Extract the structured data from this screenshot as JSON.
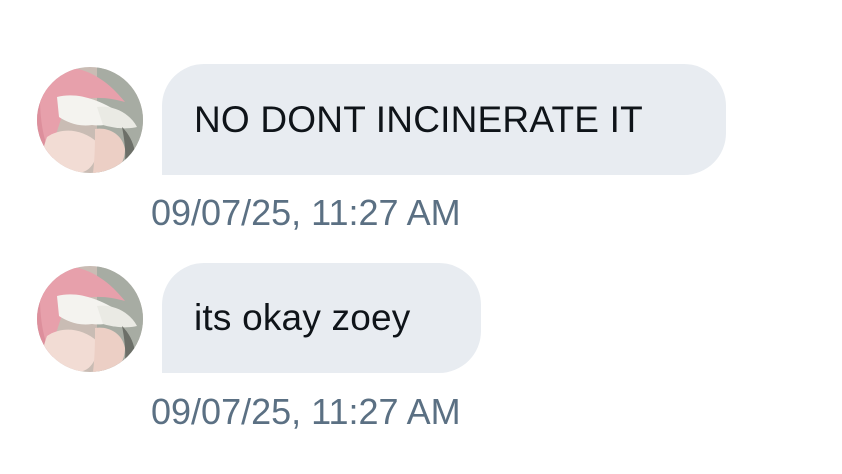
{
  "messages": [
    {
      "avatar_icon": "user-avatar-pink-hair",
      "text": "NO DONT INCINERATE IT",
      "timestamp": "09/07/25, 11:27 AM"
    },
    {
      "avatar_icon": "user-avatar-pink-hair",
      "text": "its okay zoey",
      "timestamp": "09/07/25, 11:27 AM"
    }
  ],
  "colors": {
    "bubble_background": "#e8ecf1",
    "message_text": "#0f1419",
    "timestamp_text": "#5b7083",
    "avatar_hair": "#e7a0ab",
    "avatar_skin": "#f2dcd4",
    "avatar_fabric": "#f4f3ef"
  }
}
